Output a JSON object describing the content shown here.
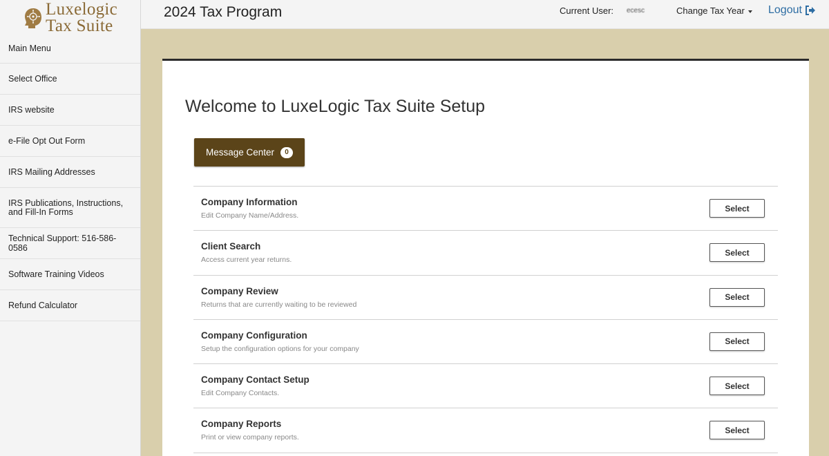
{
  "brand": {
    "line1": "Luxelogic",
    "line2": "Tax Suite",
    "color": "#8a6a36"
  },
  "sidebar": {
    "items": [
      {
        "label": "Main Menu"
      },
      {
        "label": "Select Office"
      },
      {
        "label": "IRS website"
      },
      {
        "label": "e-File Opt Out Form"
      },
      {
        "label": "IRS Mailing Addresses"
      },
      {
        "label": "IRS Publications, Instructions, and Fill-In Forms"
      },
      {
        "label": "Technical Support: 516-586-0586"
      },
      {
        "label": "Software Training Videos"
      },
      {
        "label": "Refund Calculator"
      }
    ]
  },
  "header": {
    "title": "2024 Tax Program",
    "current_user_label": "Current User:",
    "current_user_value": "ecesc",
    "tax_year_label": "Change Tax Year",
    "logout_label": "Logout"
  },
  "main": {
    "welcome": "Welcome to LuxeLogic Tax Suite Setup",
    "message_center": {
      "label": "Message Center",
      "count": "0"
    },
    "select_label": "Select",
    "rows": [
      {
        "title": "Company Information",
        "desc": "Edit Company Name/Address."
      },
      {
        "title": "Client Search",
        "desc": "Access current year returns."
      },
      {
        "title": "Company Review",
        "desc": "Returns that are currently waiting to be reviewed"
      },
      {
        "title": "Company Configuration",
        "desc": "Setup the configuration options for your company"
      },
      {
        "title": "Company Contact Setup",
        "desc": "Edit Company Contacts."
      },
      {
        "title": "Company Reports",
        "desc": "Print or view company reports."
      }
    ]
  },
  "colors": {
    "accent": "#5b4419",
    "background": "#d9cfac",
    "link": "#2d6da3"
  }
}
